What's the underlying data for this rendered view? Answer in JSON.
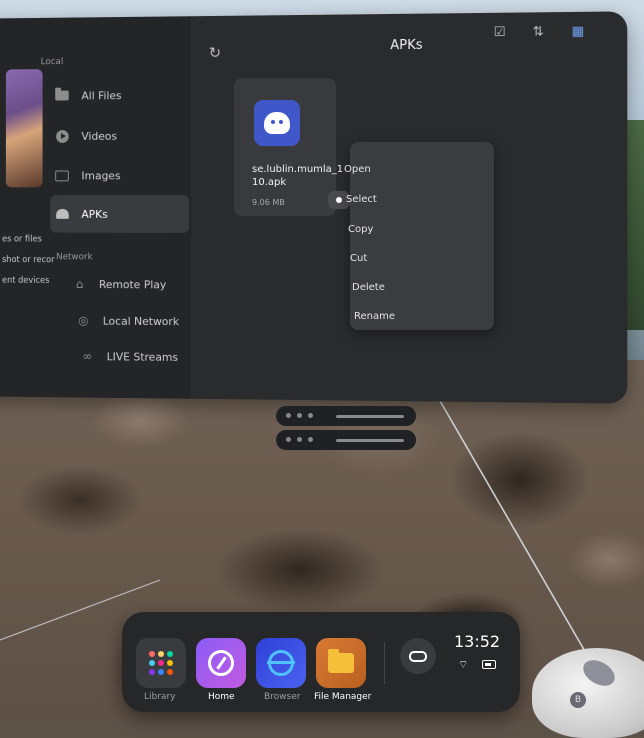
{
  "sidebar": {
    "snippets": [
      "es or files",
      "shot or recor",
      "ent devices"
    ],
    "local_label": "Local",
    "network_label": "Network",
    "items": [
      {
        "label": "All Files",
        "icon": "folder-icon"
      },
      {
        "label": "Videos",
        "icon": "play-icon"
      },
      {
        "label": "Images",
        "icon": "image-icon"
      },
      {
        "label": "APKs",
        "icon": "android-icon",
        "active": true
      },
      {
        "label": "Remote Play",
        "icon": "remote-play-icon"
      },
      {
        "label": "Local Network",
        "icon": "globe-icon"
      },
      {
        "label": "LIVE Streams",
        "icon": "stream-icon"
      }
    ]
  },
  "header": {
    "title": "APKs",
    "refresh_glyph": "↻",
    "select_glyph": "☑",
    "sort_glyph": "⇅",
    "view_glyph": "▦"
  },
  "file": {
    "name": "se.lublin.mumla_110.apk",
    "size": "9.06 MB",
    "icon": "android-app-icon"
  },
  "context_menu": {
    "items": [
      "Open",
      "Select",
      "Copy",
      "Cut",
      "Delete",
      "Rename"
    ]
  },
  "dock": {
    "apps": [
      {
        "label": "Library",
        "icon": "library-icon",
        "active": false
      },
      {
        "label": "Home",
        "icon": "home-compass-icon",
        "active": true
      },
      {
        "label": "Browser",
        "icon": "browser-globe-icon",
        "active": false
      },
      {
        "label": "File Manager",
        "icon": "file-manager-icon",
        "active": true
      }
    ],
    "time": "13:52",
    "wifi_glyph": "⌔"
  },
  "controller": {
    "button_label": "B"
  },
  "colors": {
    "panel": "#2a2b2d",
    "sidebar": "#242527",
    "accent_blue": "#6fa3f3",
    "app_icon_bg": "#3f57c8",
    "home_purple": "#8a5cf7",
    "file_manager_orange": "#d97a35"
  }
}
